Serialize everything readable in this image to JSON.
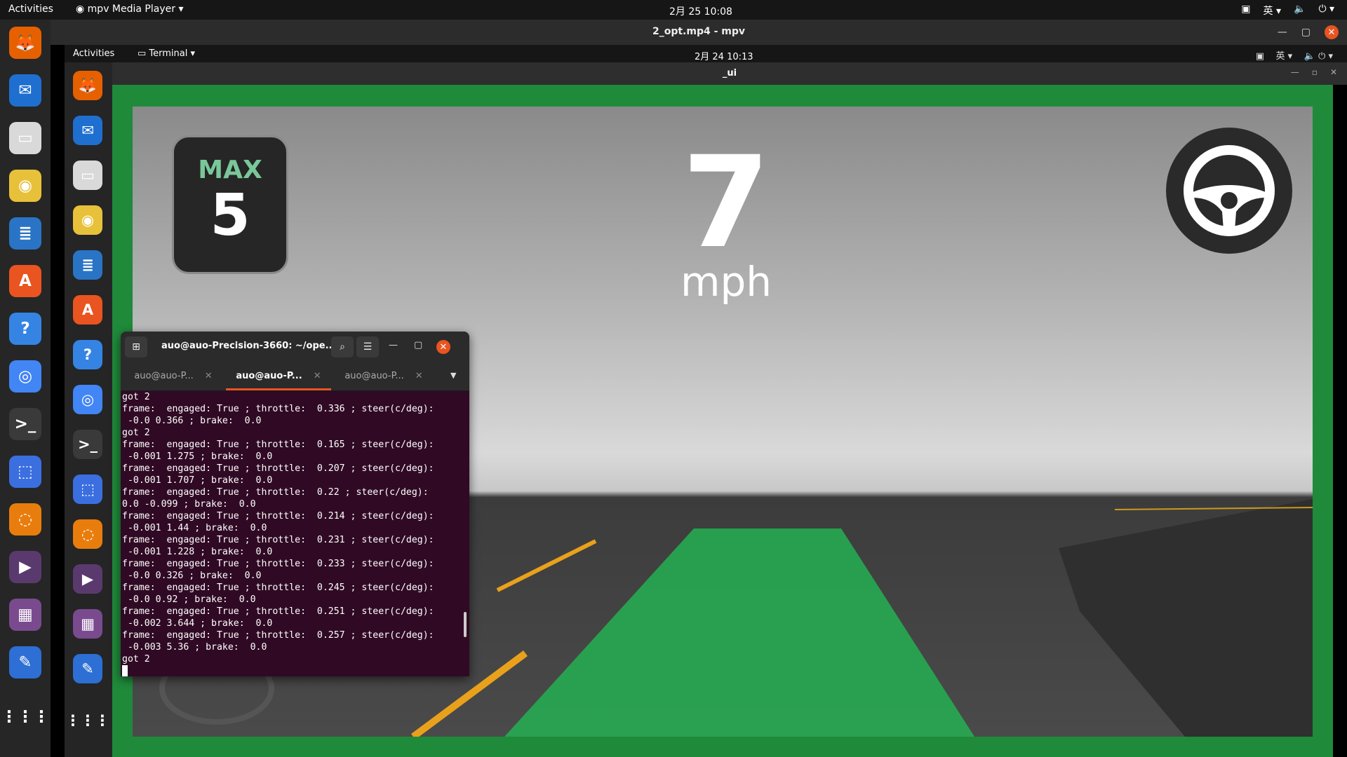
{
  "outer_topbar": {
    "activities": "Activities",
    "app_name": "mpv Media Player",
    "clock": "2月 25  10:08",
    "ime": "英"
  },
  "mpv_window": {
    "title": "2_opt.mp4 - mpv"
  },
  "inner_topbar": {
    "activities": "Activities",
    "app_name": "Terminal",
    "clock": "2月 24  10:13",
    "ime": "英"
  },
  "ui_window": {
    "title": "_ui"
  },
  "hud": {
    "max_label": "MAX",
    "max_value": "5",
    "speed": "7",
    "unit": "mph"
  },
  "terminal": {
    "title": "auo@auo-Precision-3660: ~/ope...",
    "tabs": [
      "auo@auo-P...",
      "auo@auo-P...",
      "auo@auo-P..."
    ],
    "active_tab_index": 1,
    "lines": [
      "got 2",
      "frame:  engaged: True ; throttle:  0.336 ; steer(c/deg):",
      " -0.0 0.366 ; brake:  0.0",
      "got 2",
      "frame:  engaged: True ; throttle:  0.165 ; steer(c/deg):",
      " -0.001 1.275 ; brake:  0.0",
      "frame:  engaged: True ; throttle:  0.207 ; steer(c/deg):",
      " -0.001 1.707 ; brake:  0.0",
      "frame:  engaged: True ; throttle:  0.22 ; steer(c/deg):",
      "0.0 -0.099 ; brake:  0.0",
      "frame:  engaged: True ; throttle:  0.214 ; steer(c/deg):",
      " -0.001 1.44 ; brake:  0.0",
      "frame:  engaged: True ; throttle:  0.231 ; steer(c/deg):",
      " -0.001 1.228 ; brake:  0.0",
      "frame:  engaged: True ; throttle:  0.233 ; steer(c/deg):",
      " -0.0 0.326 ; brake:  0.0",
      "frame:  engaged: True ; throttle:  0.245 ; steer(c/deg):",
      " -0.0 0.92 ; brake:  0.0",
      "frame:  engaged: True ; throttle:  0.251 ; steer(c/deg):",
      " -0.002 3.644 ; brake:  0.0",
      "frame:  engaged: True ; throttle:  0.257 ; steer(c/deg):",
      " -0.003 5.36 ; brake:  0.0",
      "got 2"
    ]
  },
  "dock_apps": [
    {
      "name": "firefox",
      "glyph": "🦊",
      "color": "#e66000"
    },
    {
      "name": "thunderbird",
      "glyph": "✉",
      "color": "#1f6fd0"
    },
    {
      "name": "files",
      "glyph": "▭",
      "color": "#d9d9d9"
    },
    {
      "name": "rhythmbox",
      "glyph": "◉",
      "color": "#e8c13a"
    },
    {
      "name": "writer",
      "glyph": "≣",
      "color": "#2a74c5"
    },
    {
      "name": "software",
      "glyph": "A",
      "color": "#e95420"
    },
    {
      "name": "help",
      "glyph": "?",
      "color": "#3584e4"
    },
    {
      "name": "chrome",
      "glyph": "◎",
      "color": "#4285f4"
    },
    {
      "name": "terminal",
      "glyph": ">_",
      "color": "#3a3a3a"
    },
    {
      "name": "screenshot",
      "glyph": "⬚",
      "color": "#3b6fe0"
    },
    {
      "name": "blender",
      "glyph": "◌",
      "color": "#e87d0d"
    },
    {
      "name": "mpv",
      "glyph": "▶",
      "color": "#5a3a6e"
    },
    {
      "name": "video-editor",
      "glyph": "▦",
      "color": "#7a4a8e"
    },
    {
      "name": "text-editor",
      "glyph": "✎",
      "color": "#2d6fd4"
    }
  ]
}
